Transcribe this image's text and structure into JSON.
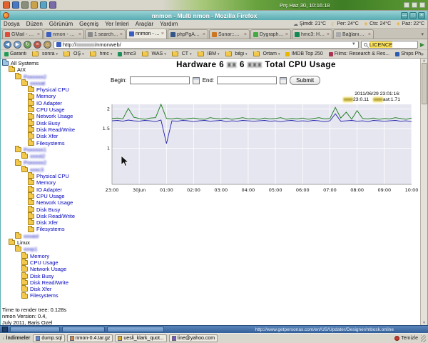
{
  "desktop": {
    "clock": "Prş Haz 30, 10:16:18",
    "taskbar": {
      "status_url": "http://www.getpersonas.com/en/US/Updater/Designer/mbosk.online"
    },
    "downloads_bar": {
      "label": "İndirmeler",
      "items": [
        {
          "label": "dump.sql",
          "icon_color": "#6688cc"
        },
        {
          "label": "nmon-0.4.tar.gz",
          "icon_color": "#cc8844"
        },
        {
          "label": "uesli_klark_quot...",
          "icon_color": "#ddaa22"
        },
        {
          "label": "line@yahoo.com",
          "icon_color": "#7755bb"
        }
      ],
      "clear_label": "Temizle"
    }
  },
  "window": {
    "title": "nnmon - Multi nmon - Mozilla Firefox"
  },
  "menubar": {
    "items": [
      "Dosya",
      "Düzen",
      "Görünüm",
      "Geçmiş",
      "Yer İmleri",
      "Araçlar",
      "Yardım"
    ],
    "weather": [
      {
        "icon": "cloud",
        "label": "Şimdi: 21°C"
      },
      {
        "icon": "moon",
        "label": "Per: 24°C"
      },
      {
        "icon": "sun",
        "label": "Cts: 24°C"
      },
      {
        "icon": "sun",
        "label": "Paz: 22°C"
      }
    ]
  },
  "tabs": [
    {
      "label": "GMail - Ta...",
      "icon_color": "#dd4b39",
      "active": false
    },
    {
      "label": "nmon - M...",
      "icon_color": "#3b5fc0",
      "active": false
    },
    {
      "label": "1 search r...",
      "icon_color": "#8a8a8a",
      "active": false
    },
    {
      "label": "nnmon - ...",
      "icon_color": "#3b5fc0",
      "active": true
    },
    {
      "label": "phpPgAd...",
      "icon_color": "#335588",
      "active": false
    },
    {
      "label": "Sunar::DÖ...",
      "icon_color": "#cc7722",
      "active": false
    },
    {
      "label": "Dygraphs...",
      "icon_color": "#44aa44",
      "active": false
    },
    {
      "label": "hmc3: Har...",
      "icon_color": "#118855",
      "active": false
    },
    {
      "label": "Bağlanıyor...",
      "icon_color": "#aaaaaa",
      "active": false
    }
  ],
  "navbar": {
    "url_prefix": "http://",
    "url_host": "xxxxxxx",
    "url_path": "/nmonweb/",
    "search_text": "LICENCE"
  },
  "bookmarks": [
    {
      "label": "Garanti",
      "type": "link",
      "icon_color": "#1f9d55"
    },
    {
      "label": "sonra",
      "type": "folder"
    },
    {
      "label": "ÖŞ",
      "type": "folder"
    },
    {
      "label": "hmc",
      "type": "folder"
    },
    {
      "label": "hmc3",
      "type": "link",
      "icon_color": "#1a8f5a"
    },
    {
      "label": "WAS",
      "type": "folder"
    },
    {
      "label": "CT",
      "type": "folder"
    },
    {
      "label": "IBM",
      "type": "folder"
    },
    {
      "label": "bilgi",
      "type": "folder"
    },
    {
      "label": "Ortam",
      "type": "folder"
    },
    {
      "label": "IMDB Top 250",
      "type": "link",
      "icon_color": "#e8b500"
    },
    {
      "label": "Films: Research & Res...",
      "type": "link",
      "icon_color": "#aa3355"
    },
    {
      "label": "Ships Photos at Mari...",
      "type": "link",
      "icon_color": "#2a5db0"
    }
  ],
  "page": {
    "title_parts": [
      {
        "text": "Hardware 6",
        "blur": false
      },
      {
        "text": "xx",
        "blur": true
      },
      {
        "text": "6",
        "blur": false
      },
      {
        "text": "xxx",
        "blur": true
      },
      {
        "text": "Total CPU Usage",
        "blur": false
      }
    ],
    "form": {
      "begin_label": "Begin:",
      "end_label": "End:",
      "submit_label": "Submit"
    },
    "tree": [
      {
        "label": "All Systems",
        "depth": 0,
        "kind": "root",
        "blur": false
      },
      {
        "label": "AIX",
        "depth": 1,
        "kind": "group",
        "blur": false
      },
      {
        "label": "Poxxxxx2",
        "depth": 2,
        "kind": "host",
        "blur": true
      },
      {
        "label": "xxxxat",
        "depth": 3,
        "kind": "host",
        "blur": true
      },
      {
        "label": "Physical CPU",
        "depth": 4,
        "kind": "metric",
        "blur": false
      },
      {
        "label": "Memory",
        "depth": 4,
        "kind": "metric",
        "blur": false
      },
      {
        "label": "IO Adapter",
        "depth": 4,
        "kind": "metric",
        "blur": false
      },
      {
        "label": "CPU Usage",
        "depth": 4,
        "kind": "metric",
        "blur": false
      },
      {
        "label": "Network Usage",
        "depth": 4,
        "kind": "metric",
        "blur": false
      },
      {
        "label": "Disk Busy",
        "depth": 4,
        "kind": "metric",
        "blur": false
      },
      {
        "label": "Disk Read/Write",
        "depth": 4,
        "kind": "metric",
        "blur": false
      },
      {
        "label": "Disk Xfer",
        "depth": 4,
        "kind": "metric",
        "blur": false
      },
      {
        "label": "Filesystems",
        "depth": 4,
        "kind": "metric",
        "blur": false
      },
      {
        "label": "Poxxxxx1",
        "depth": 2,
        "kind": "host",
        "blur": true
      },
      {
        "label": "xxxst2",
        "depth": 3,
        "kind": "host",
        "blur": true
      },
      {
        "label": "Poxxxxx2",
        "depth": 2,
        "kind": "host",
        "blur": true
      },
      {
        "label": "xxxc3",
        "depth": 3,
        "kind": "host",
        "blur": true
      },
      {
        "label": "Physical CPU",
        "depth": 4,
        "kind": "metric",
        "blur": false
      },
      {
        "label": "Memory",
        "depth": 4,
        "kind": "metric",
        "blur": false
      },
      {
        "label": "IO Adapter",
        "depth": 4,
        "kind": "metric",
        "blur": false
      },
      {
        "label": "CPU Usage",
        "depth": 4,
        "kind": "metric",
        "blur": false
      },
      {
        "label": "Network Usage",
        "depth": 4,
        "kind": "metric",
        "blur": false
      },
      {
        "label": "Disk Busy",
        "depth": 4,
        "kind": "metric",
        "blur": false
      },
      {
        "label": "Disk Read/Write",
        "depth": 4,
        "kind": "metric",
        "blur": false
      },
      {
        "label": "Disk Xfer",
        "depth": 4,
        "kind": "metric",
        "blur": false
      },
      {
        "label": "Filesystems",
        "depth": 4,
        "kind": "metric",
        "blur": false
      },
      {
        "label": "xxxast",
        "depth": 2,
        "kind": "host",
        "blur": true
      },
      {
        "label": "Linux",
        "depth": 1,
        "kind": "group",
        "blur": false
      },
      {
        "label": "xxxp1",
        "depth": 2,
        "kind": "host",
        "blur": true
      },
      {
        "label": "Memory",
        "depth": 3,
        "kind": "metric",
        "blur": false
      },
      {
        "label": "CPU Usage",
        "depth": 3,
        "kind": "metric",
        "blur": false
      },
      {
        "label": "Network Usage",
        "depth": 3,
        "kind": "metric",
        "blur": false
      },
      {
        "label": "Disk Busy",
        "depth": 3,
        "kind": "metric",
        "blur": false
      },
      {
        "label": "Disk Read/Write",
        "depth": 3,
        "kind": "metric",
        "blur": false
      },
      {
        "label": "Disk Xfer",
        "depth": 3,
        "kind": "metric",
        "blur": false
      },
      {
        "label": "Filesystems",
        "depth": 3,
        "kind": "metric",
        "blur": false
      }
    ],
    "footer_lines": [
      "Time to render tree: 0.128s",
      "nmon Version: 0.4,",
      "July 2011, Baris Ozel"
    ]
  },
  "chart_data": {
    "type": "line",
    "title": "Total CPU Usage",
    "x_labels": [
      "23:00",
      "30Jun",
      "01:00",
      "02:00",
      "03:00",
      "04:00",
      "05:00",
      "06:00",
      "07:00",
      "08:00",
      "09:00",
      "10:00"
    ],
    "ylim": [
      0.08,
      2.12
    ],
    "yticks": [
      1,
      1.5,
      2
    ],
    "grid": true,
    "legend_position": "top-right",
    "cursor_datetime": "2011/06/29 23:01:16:",
    "series": [
      {
        "legend_hidden": "xxxx",
        "legend_visible": "23",
        "legend_value": "0.11",
        "color": "#2222aa",
        "values": [
          1.7,
          1.71,
          1.69,
          1.72,
          1.7,
          1.69,
          1.71,
          1.7,
          1.68,
          1.72,
          1.12,
          1.7,
          1.69,
          1.71,
          1.7,
          1.68,
          1.7,
          1.71,
          1.69,
          1.7,
          1.71,
          1.68,
          1.7,
          1.69,
          1.71,
          1.7,
          1.69,
          1.7,
          1.71,
          1.69,
          1.7,
          1.68,
          1.7,
          1.71,
          1.69,
          1.7,
          1.69,
          1.71,
          1.7,
          1.68,
          1.7,
          1.88,
          1.69,
          1.7,
          1.71,
          1.69,
          1.7,
          1.68,
          1.71,
          1.7,
          1.69,
          1.7,
          1.71,
          1.69,
          1.7,
          1.68
        ]
      },
      {
        "legend_hidden": "xxxx",
        "legend_visible": "ast",
        "legend_value": "1.71",
        "color": "#117711",
        "values": [
          1.76,
          1.77,
          1.75,
          2.02,
          1.79,
          1.76,
          1.74,
          1.77,
          1.78,
          2.28,
          1.76,
          1.75,
          1.77,
          1.74,
          1.76,
          1.77,
          1.75,
          1.74,
          1.78,
          1.76,
          1.75,
          1.77,
          1.74,
          1.76,
          1.78,
          1.75,
          1.76,
          1.74,
          1.77,
          1.75,
          1.76,
          1.78,
          1.74,
          1.76,
          1.75,
          1.77,
          1.74,
          1.76,
          1.78,
          1.75,
          1.76,
          2.04,
          1.77,
          1.92,
          1.74,
          1.96,
          1.76,
          1.75,
          1.77,
          1.74,
          1.76,
          1.75,
          1.78,
          1.76,
          1.74,
          1.77
        ]
      }
    ]
  }
}
